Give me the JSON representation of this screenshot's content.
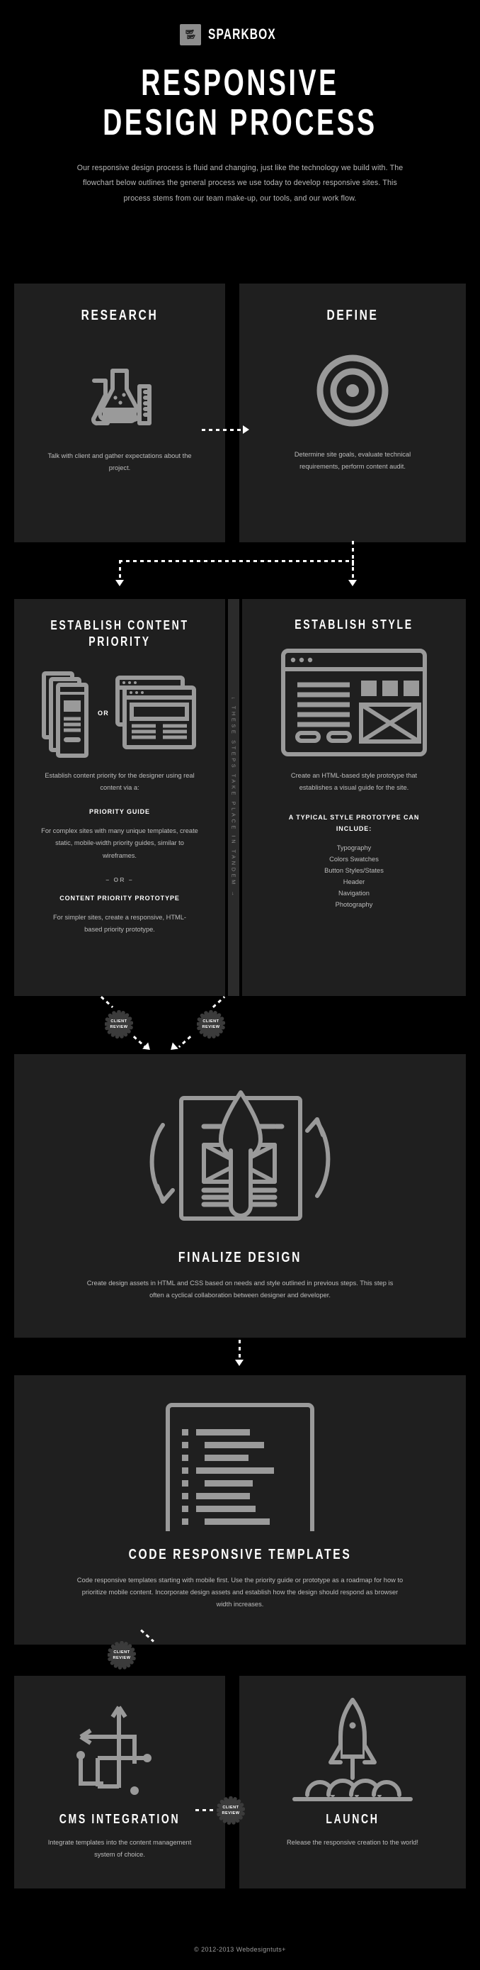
{
  "brand": {
    "name": "SPARKBOX",
    "logo_icon": "sparkbox-logo-icon"
  },
  "title": {
    "line1": "RESPONSIVE",
    "line2": "DESIGN PROCESS"
  },
  "intro": "Our responsive design process is fluid and changing, just like the technology we build with. The flowchart below outlines the general process we use today to develop responsive sites. This process stems from our team make-up, our tools, and our work flow.",
  "steps": {
    "research": {
      "title": "RESEARCH",
      "icon": "beakers-flask-icon",
      "body": "Talk with client and gather expectations about the project."
    },
    "define": {
      "title": "DEFINE",
      "icon": "target-bullseye-icon",
      "body": "Determine site goals, evaluate technical requirements, perform content audit."
    },
    "content_priority": {
      "title": "ESTABLISH CONTENT PRIORITY",
      "icon_left": "mobile-wireframe-stack-icon",
      "icon_right": "browser-wireframe-stack-icon",
      "or_label": "OR",
      "body": "Establish content priority for the designer using real content via a:",
      "subhead_1": "PRIORITY GUIDE",
      "body_1": "For complex sites with many unique templates, create static, mobile-width priority guides, similar to wireframes.",
      "separator": "– OR –",
      "subhead_2": "CONTENT PRIORITY PROTOTYPE",
      "body_2": "For simpler sites, create a responsive, HTML-based priority prototype."
    },
    "establish_style": {
      "title": "ESTABLISH STYLE",
      "icon": "style-prototype-browser-icon",
      "body": "Create an HTML-based style prototype that establishes a visual guide for the site.",
      "subhead": "A TYPICAL STYLE PROTOTYPE CAN INCLUDE:",
      "items": [
        "Typography",
        "Colors Swatches",
        "Button Styles/States",
        "Header",
        "Navigation",
        "Photography"
      ]
    },
    "finalize_design": {
      "title": "FINALIZE DESIGN",
      "icon": "paintbrush-wireframe-cycle-icon",
      "body": "Create design assets in HTML and CSS based on needs and style outlined in previous steps. This step is often a cyclical collaboration between designer and developer."
    },
    "code_templates": {
      "title": "CODE RESPONSIVE TEMPLATES",
      "icon": "code-editor-icon",
      "body": "Code responsive templates starting with mobile first. Use the priority guide or prototype as a roadmap for how to prioritize mobile content. Incorporate design assets and establish how the design should respond as browser width increases."
    },
    "cms_integration": {
      "title": "CMS INTEGRATION",
      "icon": "node-network-arrows-icon",
      "body": "Integrate templates into the content management system of choice."
    },
    "launch": {
      "title": "LAUNCH",
      "icon": "rocket-launch-icon",
      "body": "Release the responsive creation to the world!"
    }
  },
  "tandem_note": "↓ THESE STEPS TAKE PLACE IN TANDEM →",
  "client_review": {
    "line1": "CLIENT",
    "line2": "REVIEW"
  },
  "footer": "© 2012-2013 Webdesigntuts+",
  "colors": {
    "background": "#000000",
    "panel": "#1f1f1f",
    "accent": "#9a9a9a",
    "text": "#bdbdbd",
    "heading": "#ffffff"
  }
}
